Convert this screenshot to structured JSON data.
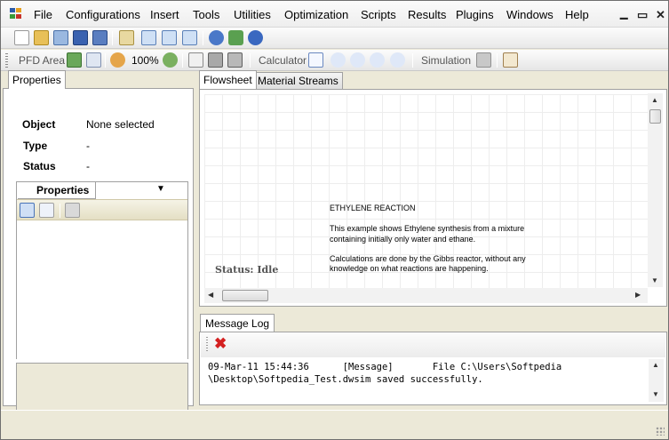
{
  "menu": {
    "items": [
      "File",
      "Configurations",
      "Insert",
      "Tools",
      "Utilities",
      "Optimization",
      "Scripts",
      "Results",
      "Plugins",
      "Windows",
      "Help"
    ],
    "window_controls": [
      "⊗",
      "▭",
      "✕"
    ]
  },
  "toolbar": {
    "pfd_label": "PFD Area",
    "zoom_level": "100%",
    "calculator_label": "Calculator",
    "simulation_label": "Simulation"
  },
  "left_panel": {
    "tab_label": "Properties",
    "object_label": "Object",
    "object_value": "None selected",
    "type_label": "Type",
    "type_value": "-",
    "status_label": "Status",
    "status_value": "-",
    "inner_tab_label": "Properties"
  },
  "doc_tabs": [
    "Flowsheet",
    "Material Streams"
  ],
  "flowsheet": {
    "title": "ETHYLENE REACTION",
    "line1": "This example shows Ethylene synthesis from a mixture",
    "line2": "containing initially only water and ethane.",
    "line3": "Calculations are done by the Gibbs reactor, without any",
    "line4": "knowledge on what reactions are happening.",
    "status": "Status: Idle"
  },
  "message_log": {
    "tab_label": "Message Log",
    "line1": "09-Mar-11 15:44:36      [Message]       File C:\\Users\\Softpedia",
    "line2": "\\Desktop\\Softpedia_Test.dwsim saved successfully."
  },
  "colors": {
    "accent_blue": "#2b5aa8",
    "delete_red": "#d42020",
    "window_bg": "#ece9d8"
  }
}
